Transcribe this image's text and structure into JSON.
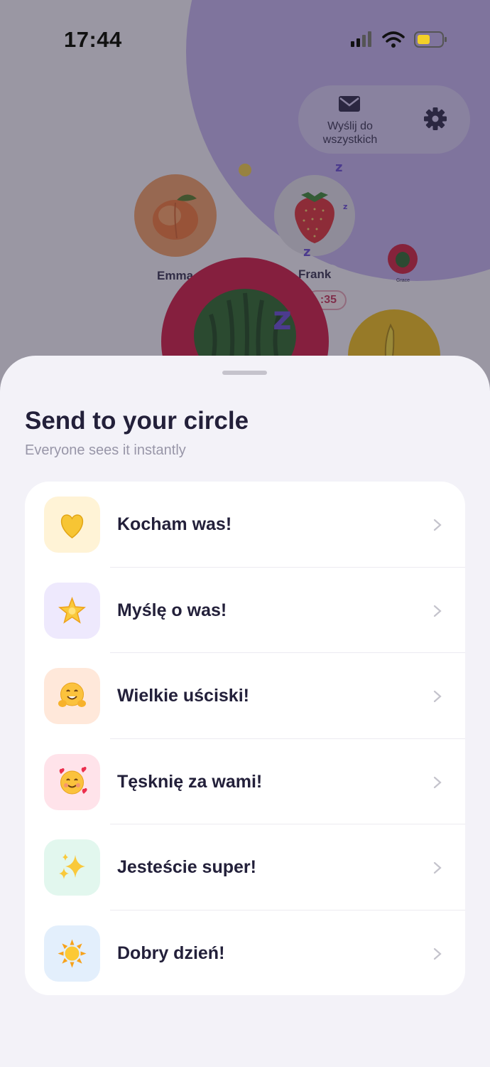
{
  "status_bar": {
    "time": "17:44"
  },
  "background": {
    "send_all_label": "Wyślij do wszystkich",
    "members": [
      {
        "name": "Emma",
        "fruit": "peach"
      },
      {
        "name": "Frank",
        "fruit": "strawberry"
      }
    ],
    "timer_fragment": ":35",
    "small_member_name": "Grace"
  },
  "sheet": {
    "title": "Send to your circle",
    "subtitle": "Everyone sees it instantly",
    "items": [
      {
        "label": "Kocham was!",
        "icon": "yellow-heart-icon",
        "tile_color": "#fff3d6"
      },
      {
        "label": "Myślę o was!",
        "icon": "glowing-star-icon",
        "tile_color": "#eee9fd"
      },
      {
        "label": "Wielkie uściski!",
        "icon": "hugging-face-icon",
        "tile_color": "#ffe8da"
      },
      {
        "label": "Tęsknię za wami!",
        "icon": "smiling-face-with-hearts-icon",
        "tile_color": "#ffe3ea"
      },
      {
        "label": "Jesteście super!",
        "icon": "sparkles-icon",
        "tile_color": "#e2f7ee"
      },
      {
        "label": "Dobry dzień!",
        "icon": "sun-icon",
        "tile_color": "#e3effc"
      }
    ]
  }
}
